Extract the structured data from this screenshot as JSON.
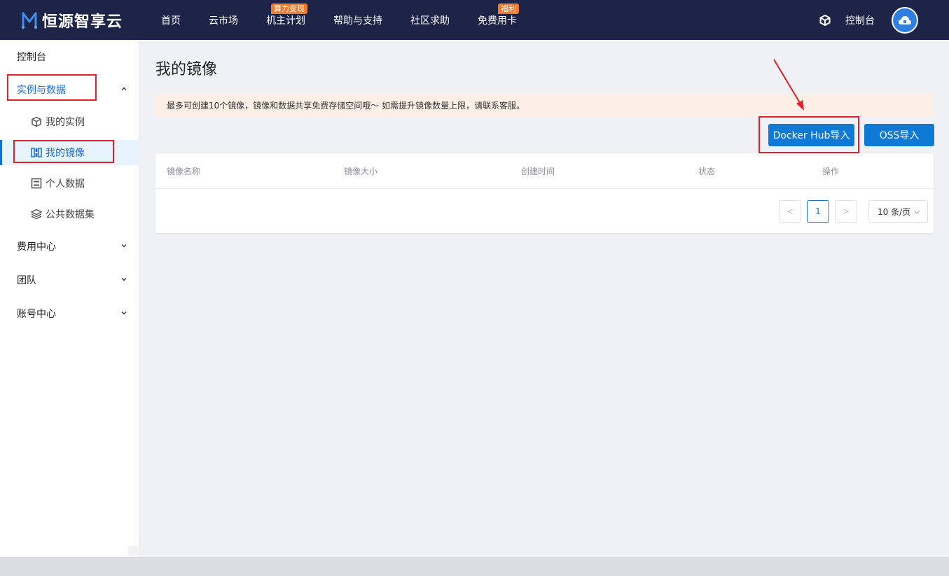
{
  "brand": {
    "name": "恒源智享云"
  },
  "nav": {
    "items": [
      {
        "label": "首页",
        "badge": ""
      },
      {
        "label": "云市场",
        "badge": ""
      },
      {
        "label": "机主计划",
        "badge": "算力变现"
      },
      {
        "label": "帮助与支持",
        "badge": ""
      },
      {
        "label": "社区求助",
        "badge": ""
      },
      {
        "label": "免费用卡",
        "badge": "福利"
      }
    ],
    "console": "控制台"
  },
  "sidebar": {
    "top": "控制台",
    "groups": [
      {
        "label": "实例与数据",
        "expanded": true
      },
      {
        "label": "费用中心",
        "expanded": false
      },
      {
        "label": "团队",
        "expanded": false
      },
      {
        "label": "账号中心",
        "expanded": false
      }
    ],
    "sub_items": [
      {
        "label": "我的实例",
        "icon": "cube-icon"
      },
      {
        "label": "我的镜像",
        "icon": "image-icon"
      },
      {
        "label": "个人数据",
        "icon": "disk-icon"
      },
      {
        "label": "公共数据集",
        "icon": "layers-icon"
      }
    ]
  },
  "main": {
    "title": "我的镜像",
    "notice": "最多可创建10个镜像，镜像和数据共享免费存储空间哦～ 如需提升镜像数量上限，请联系客服。",
    "buttons": {
      "docker_hub": "Docker Hub导入",
      "oss": "OSS导入"
    },
    "table": {
      "columns": [
        "镜像名称",
        "镜像大小",
        "创建时间",
        "状态",
        "操作"
      ],
      "rows": []
    },
    "pagination": {
      "prev": "<",
      "current": "1",
      "next": ">",
      "page_size": "10 条/页"
    }
  },
  "colors": {
    "topbar": "#1d2448",
    "accent": "#1a6fd1",
    "button": "#0f7ad6",
    "badge": "#f07a2b",
    "annotation": "#e0202a"
  }
}
